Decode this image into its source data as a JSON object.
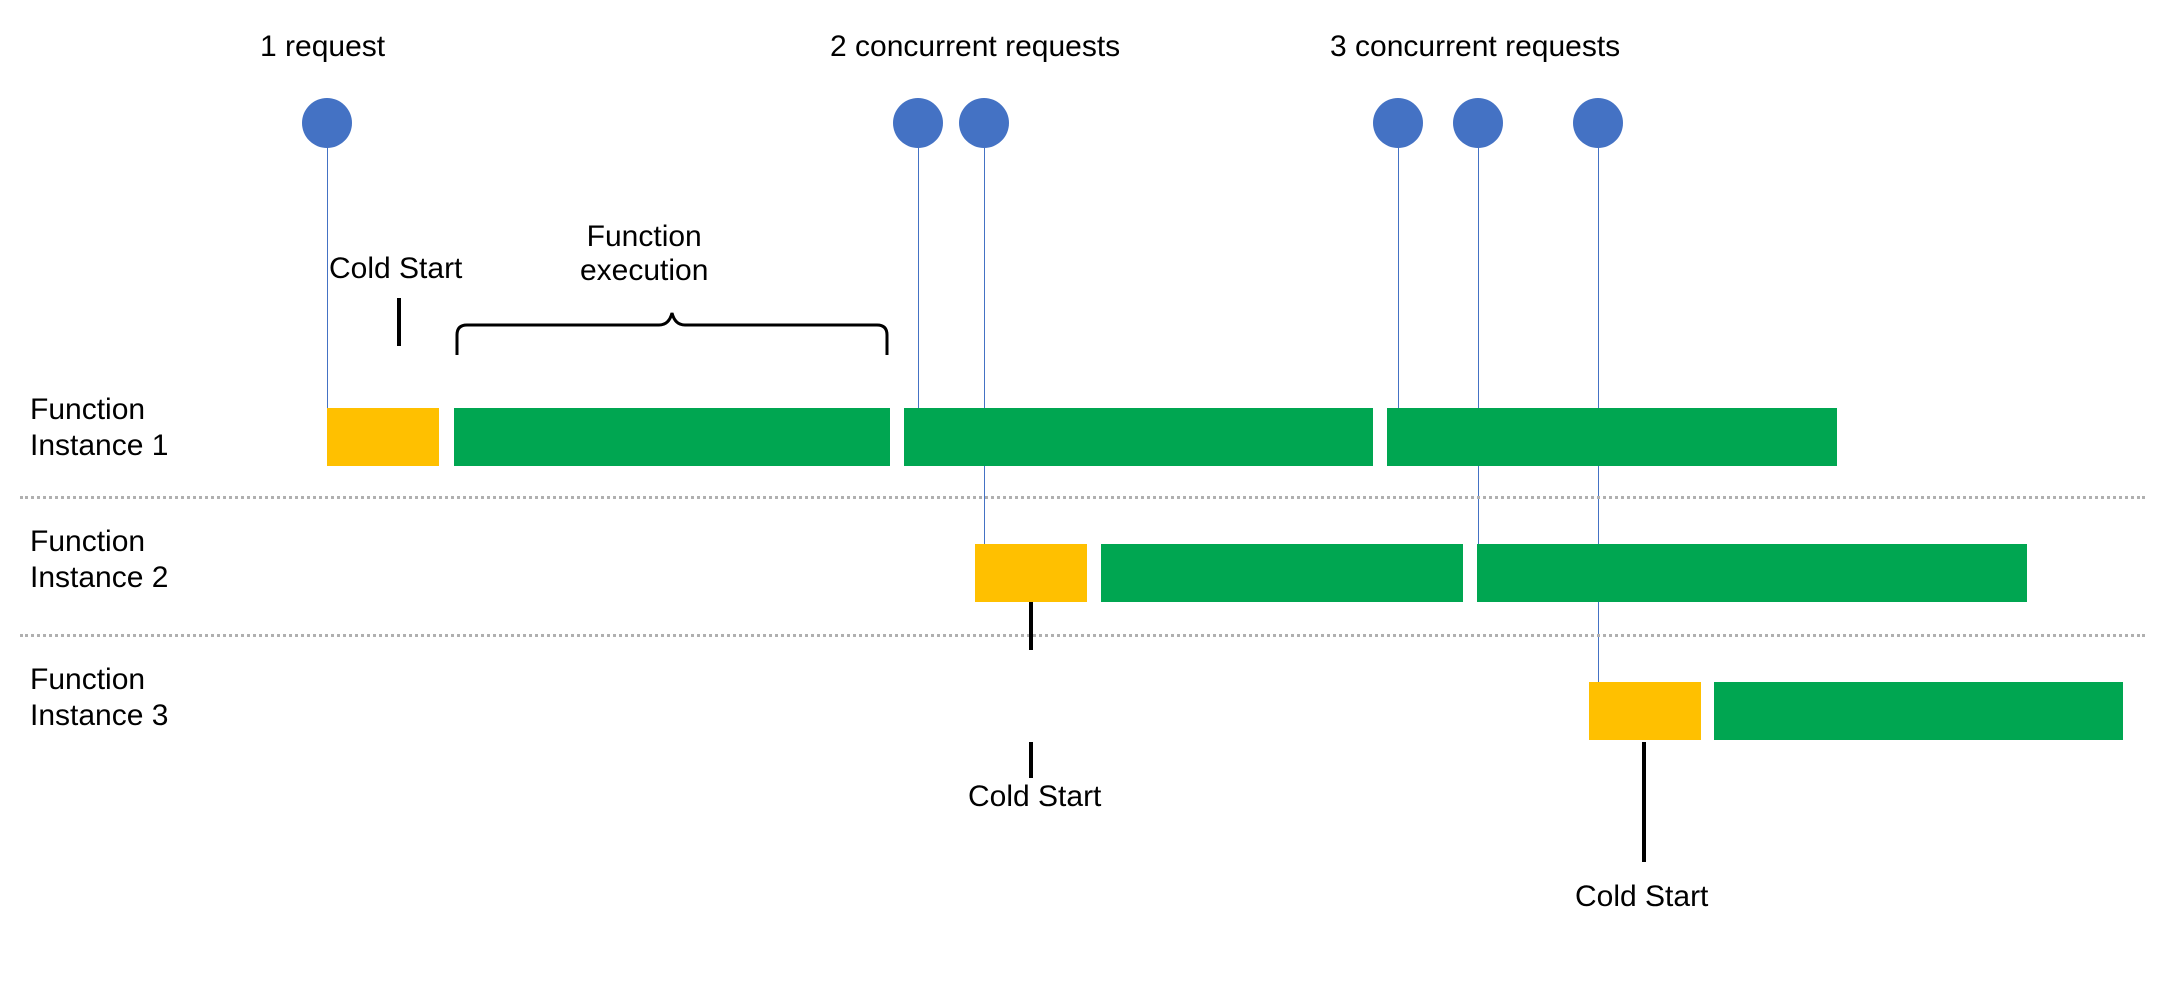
{
  "headers": {
    "one_request": "1 request",
    "two_requests": "2 concurrent requests",
    "three_requests": "3 concurrent requests"
  },
  "annotations": {
    "cold_start_top": "Cold Start",
    "function_execution": "Function\nexecution",
    "cold_start_mid": "Cold Start",
    "cold_start_bottom": "Cold Start"
  },
  "rows": {
    "instance1": "Function\nInstance 1",
    "instance2": "Function\nInstance 2",
    "instance3": "Function\nInstance 3"
  },
  "chart_data": {
    "type": "table",
    "colors": {
      "cold_start": "#FFC000",
      "execution": "#00A651",
      "request": "#4472C4"
    },
    "request_groups": [
      {
        "label": "1 request",
        "request_times": [
          0
        ]
      },
      {
        "label": "2 concurrent requests",
        "request_times": [
          31,
          35
        ]
      },
      {
        "label": "3 concurrent requests",
        "request_times": [
          58,
          63,
          70
        ]
      }
    ],
    "instances": [
      {
        "name": "Function Instance 1",
        "segments": [
          {
            "kind": "cold_start",
            "start": 0,
            "end": 6
          },
          {
            "kind": "execution",
            "start": 7,
            "end": 31
          },
          {
            "kind": "execution",
            "start": 32,
            "end": 57
          },
          {
            "kind": "execution",
            "start": 58,
            "end": 83
          }
        ]
      },
      {
        "name": "Function Instance 2",
        "segments": [
          {
            "kind": "cold_start",
            "start": 35,
            "end": 41
          },
          {
            "kind": "execution",
            "start": 42,
            "end": 62
          },
          {
            "kind": "execution",
            "start": 63,
            "end": 93
          }
        ]
      },
      {
        "name": "Function Instance 3",
        "segments": [
          {
            "kind": "cold_start",
            "start": 70,
            "end": 76
          },
          {
            "kind": "execution",
            "start": 77,
            "end": 100
          }
        ]
      }
    ]
  }
}
